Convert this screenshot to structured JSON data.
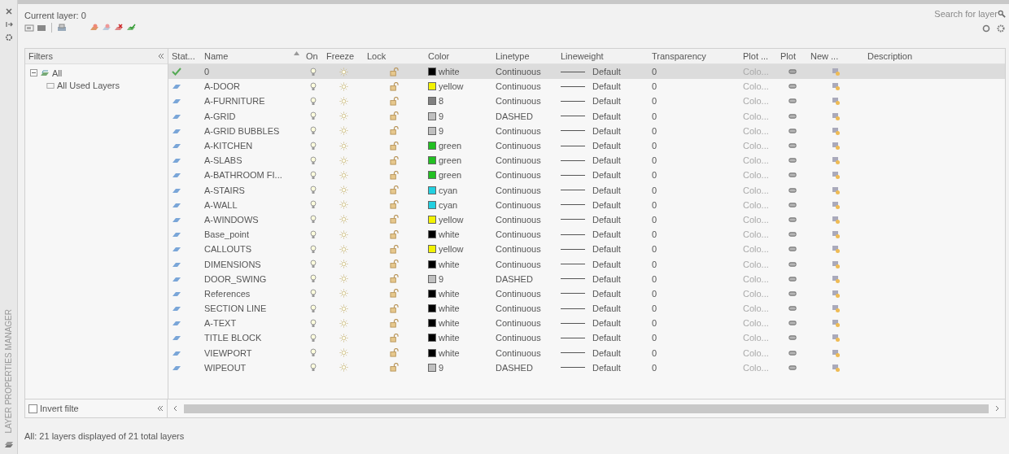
{
  "side_panel": {
    "title": "LAYER PROPERTIES MANAGER"
  },
  "header": {
    "current_layer": "Current layer: 0",
    "search": {
      "placeholder": "Search for layer"
    }
  },
  "filters": {
    "title": "Filters",
    "tree": [
      {
        "label": "All",
        "expanded": true,
        "selected": false,
        "children": [
          {
            "label": "All Used Layers",
            "selected": false
          }
        ]
      }
    ],
    "invert": {
      "label": "Invert filte",
      "checked": false
    }
  },
  "table": {
    "columns": [
      "Stat...",
      "Name",
      "On",
      "Freeze",
      "Lock",
      "Color",
      "Linetype",
      "Lineweight",
      "Transparency",
      "Plot ...",
      "Plot",
      "New ...",
      "Description"
    ],
    "rows": [
      {
        "current": true,
        "name": "0",
        "on": true,
        "frozen": false,
        "locked": false,
        "color_name": "white",
        "color": "#000000",
        "linetype": "Continuous",
        "lineweight": "Default",
        "transparency": "0",
        "plot_style": "Colo...",
        "selected": true
      },
      {
        "current": false,
        "name": "A-DOOR",
        "on": true,
        "frozen": false,
        "locked": false,
        "color_name": "yellow",
        "color": "#f2f200",
        "linetype": "Continuous",
        "lineweight": "Default",
        "transparency": "0",
        "plot_style": "Colo...",
        "selected": false
      },
      {
        "current": false,
        "name": "A-FURNITURE",
        "on": true,
        "frozen": false,
        "locked": false,
        "color_name": "8",
        "color": "#808080",
        "linetype": "Continuous",
        "lineweight": "Default",
        "transparency": "0",
        "plot_style": "Colo...",
        "selected": false
      },
      {
        "current": false,
        "name": "A-GRID",
        "on": true,
        "frozen": false,
        "locked": false,
        "color_name": "9",
        "color": "#c0c0c0",
        "linetype": "DASHED",
        "lineweight": "Default",
        "transparency": "0",
        "plot_style": "Colo...",
        "selected": false
      },
      {
        "current": false,
        "name": "A-GRID BUBBLES",
        "on": true,
        "frozen": false,
        "locked": false,
        "color_name": "9",
        "color": "#c0c0c0",
        "linetype": "Continuous",
        "lineweight": "Default",
        "transparency": "0",
        "plot_style": "Colo...",
        "selected": false
      },
      {
        "current": false,
        "name": "A-KITCHEN",
        "on": true,
        "frozen": false,
        "locked": false,
        "color_name": "green",
        "color": "#22c022",
        "linetype": "Continuous",
        "lineweight": "Default",
        "transparency": "0",
        "plot_style": "Colo...",
        "selected": false
      },
      {
        "current": false,
        "name": "A-SLABS",
        "on": true,
        "frozen": false,
        "locked": false,
        "color_name": "green",
        "color": "#22c022",
        "linetype": "Continuous",
        "lineweight": "Default",
        "transparency": "0",
        "plot_style": "Colo...",
        "selected": false
      },
      {
        "current": false,
        "name": "A-BATHROOM FI...",
        "on": true,
        "frozen": false,
        "locked": false,
        "color_name": "green",
        "color": "#22c022",
        "linetype": "Continuous",
        "lineweight": "Default",
        "transparency": "0",
        "plot_style": "Colo...",
        "selected": false
      },
      {
        "current": false,
        "name": "A-STAIRS",
        "on": true,
        "frozen": false,
        "locked": false,
        "color_name": "cyan",
        "color": "#22d0e0",
        "linetype": "Continuous",
        "lineweight": "Default",
        "transparency": "0",
        "plot_style": "Colo...",
        "selected": false
      },
      {
        "current": false,
        "name": "A-WALL",
        "on": true,
        "frozen": false,
        "locked": false,
        "color_name": "cyan",
        "color": "#22d0e0",
        "linetype": "Continuous",
        "lineweight": "Default",
        "transparency": "0",
        "plot_style": "Colo...",
        "selected": false
      },
      {
        "current": false,
        "name": "A-WINDOWS",
        "on": true,
        "frozen": false,
        "locked": false,
        "color_name": "yellow",
        "color": "#f2f200",
        "linetype": "Continuous",
        "lineweight": "Default",
        "transparency": "0",
        "plot_style": "Colo...",
        "selected": false
      },
      {
        "current": false,
        "name": "Base_point",
        "on": true,
        "frozen": false,
        "locked": false,
        "color_name": "white",
        "color": "#000000",
        "linetype": "Continuous",
        "lineweight": "Default",
        "transparency": "0",
        "plot_style": "Colo...",
        "selected": false
      },
      {
        "current": false,
        "name": "CALLOUTS",
        "on": true,
        "frozen": false,
        "locked": false,
        "color_name": "yellow",
        "color": "#f2f200",
        "linetype": "Continuous",
        "lineweight": "Default",
        "transparency": "0",
        "plot_style": "Colo...",
        "selected": false
      },
      {
        "current": false,
        "name": "DIMENSIONS",
        "on": true,
        "frozen": false,
        "locked": false,
        "color_name": "white",
        "color": "#000000",
        "linetype": "Continuous",
        "lineweight": "Default",
        "transparency": "0",
        "plot_style": "Colo...",
        "selected": false
      },
      {
        "current": false,
        "name": "DOOR_SWING",
        "on": true,
        "frozen": false,
        "locked": false,
        "color_name": "9",
        "color": "#c0c0c0",
        "linetype": "DASHED",
        "lineweight": "Default",
        "transparency": "0",
        "plot_style": "Colo...",
        "selected": false
      },
      {
        "current": false,
        "name": "References",
        "on": true,
        "frozen": false,
        "locked": false,
        "color_name": "white",
        "color": "#000000",
        "linetype": "Continuous",
        "lineweight": "Default",
        "transparency": "0",
        "plot_style": "Colo...",
        "selected": false
      },
      {
        "current": false,
        "name": "SECTION LINE",
        "on": true,
        "frozen": false,
        "locked": false,
        "color_name": "white",
        "color": "#000000",
        "linetype": "Continuous",
        "lineweight": "Default",
        "transparency": "0",
        "plot_style": "Colo...",
        "selected": false
      },
      {
        "current": false,
        "name": "A-TEXT",
        "on": true,
        "frozen": false,
        "locked": false,
        "color_name": "white",
        "color": "#000000",
        "linetype": "Continuous",
        "lineweight": "Default",
        "transparency": "0",
        "plot_style": "Colo...",
        "selected": false
      },
      {
        "current": false,
        "name": "TITLE BLOCK",
        "on": true,
        "frozen": false,
        "locked": false,
        "color_name": "white",
        "color": "#000000",
        "linetype": "Continuous",
        "lineweight": "Default",
        "transparency": "0",
        "plot_style": "Colo...",
        "selected": false
      },
      {
        "current": false,
        "name": "VIEWPORT",
        "on": true,
        "frozen": false,
        "locked": false,
        "color_name": "white",
        "color": "#000000",
        "linetype": "Continuous",
        "lineweight": "Default",
        "transparency": "0",
        "plot_style": "Colo...",
        "selected": false
      },
      {
        "current": false,
        "name": "WIPEOUT",
        "on": true,
        "frozen": false,
        "locked": false,
        "color_name": "9",
        "color": "#c0c0c0",
        "linetype": "DASHED",
        "lineweight": "Default",
        "transparency": "0",
        "plot_style": "Colo...",
        "selected": false
      }
    ]
  },
  "status_bar": "All: 21 layers displayed of 21 total layers"
}
